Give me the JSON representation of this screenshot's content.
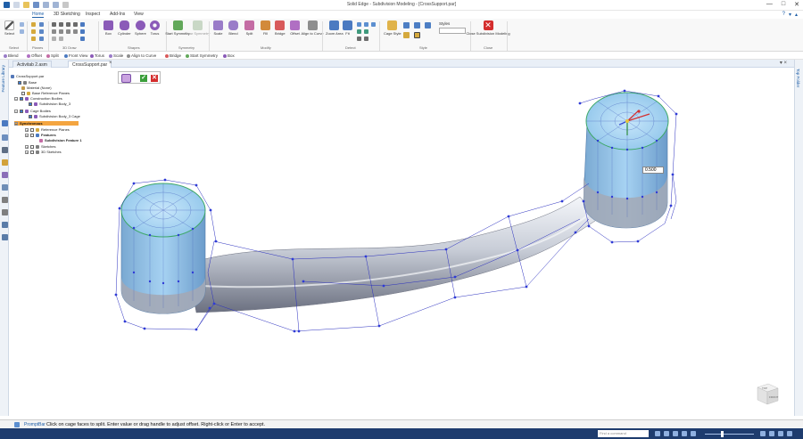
{
  "window": {
    "title": "Solid Edge - Subdivision Modeling - [CrossSupport.par]",
    "controls": [
      "—",
      "□",
      "✕"
    ]
  },
  "menu": {
    "tabs": [
      "Home",
      "3D Sketching",
      "Inspect",
      "Add-Ins",
      "View"
    ],
    "active": "Home"
  },
  "ribbon": {
    "select_label": "Select",
    "groups": [
      "Select",
      "Planes",
      "3D Draw",
      "Shapes",
      "Symmetry",
      "Modify",
      "Detect",
      "Style",
      "Close"
    ],
    "shapes": [
      "Box",
      "Cylinder",
      "Sphere",
      "Torus"
    ],
    "symmetry": [
      "Start Symmetry",
      "Clear Symmetry"
    ],
    "modify": [
      "Scale",
      "Blend",
      "Split",
      "Fill",
      "Bridge",
      "Offset",
      "Align to Curve"
    ],
    "detect": [
      "Zoom Area",
      "Fit"
    ],
    "style": [
      "Cage Style",
      "Styles"
    ],
    "close": "Close Subdivision Modeling"
  },
  "command_bar": {
    "items": [
      "Blend",
      "Offset",
      "Split",
      "Front View",
      "Torus",
      "Scale",
      "Align to Curve",
      "Bridge",
      "Start Symmetry",
      "Box"
    ]
  },
  "doc_tabs": {
    "tabs": [
      "Activitab 2.asm",
      "CrossSupport.par"
    ],
    "active": "CrossSupport.par"
  },
  "left_strip": {
    "label": "Feature Library"
  },
  "right_strip": {
    "label": "Top Folder"
  },
  "tree": {
    "root": "CrossSupport.par",
    "nodes": [
      {
        "label": "Base"
      },
      {
        "label": "Material (None)"
      },
      {
        "label": "Base Reference Planes"
      },
      {
        "label": "Construction Bodies"
      },
      {
        "label": "Subdivision Body_3"
      },
      {
        "label": "Cage Bodies"
      },
      {
        "label": "Subdivision Body_3 Cage"
      },
      {
        "label": "Synchronous"
      },
      {
        "label": "Reference Planes"
      },
      {
        "label": "Features"
      },
      {
        "label": "Subdivision Feature 1"
      },
      {
        "label": "Sketches"
      },
      {
        "label": "3D Sketches"
      }
    ]
  },
  "offset_value": "0.500",
  "prompt": {
    "label": "PromptBar",
    "text": "Click on cage faces to split.  Enter value or drag handle to adjust offset.  Right-click or Enter to accept."
  },
  "status": {
    "find_placeholder": "Find a command"
  },
  "navcube": {
    "top": "TOP",
    "front": "FRONT"
  },
  "colors": {
    "accent": "#1f5fa8",
    "selected_node": "#f4a540",
    "status_bg": "#1e3c6e",
    "cage_face": "#8fc5ea",
    "cage_edge": "#2a2fbf"
  }
}
